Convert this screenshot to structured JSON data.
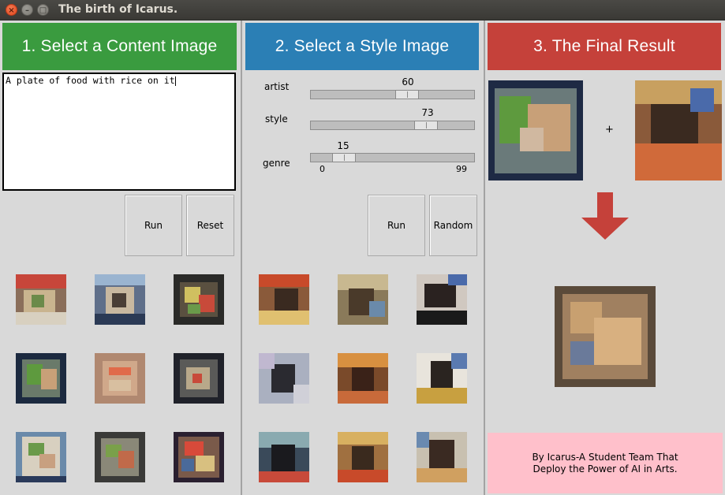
{
  "window": {
    "title": "The birth of Icarus."
  },
  "panel1": {
    "header": "1. Select a Content Image",
    "text_input": "A plate of food with rice on it",
    "run_label": "Run",
    "reset_label": "Reset"
  },
  "panel2": {
    "header": "2. Select a Style Image",
    "sliders": [
      {
        "label": "artist",
        "value": "60"
      },
      {
        "label": "style",
        "value": "73"
      },
      {
        "label": "genre",
        "value": "15",
        "min": "0",
        "max": "99"
      }
    ],
    "run_label": "Run",
    "random_label": "Random"
  },
  "panel3": {
    "header": "3. The Final Result",
    "plus": "+",
    "footer_line1": "By Icarus-A Student Team That",
    "footer_line2": "Deploy the Power of AI in Arts."
  },
  "colors": {
    "header1": "#3a9b3f",
    "header2": "#2b7fb5",
    "header3": "#c5413a",
    "footer_bg": "#ffc0cb",
    "arrow": "#c5413a"
  },
  "icons": [
    "close-icon",
    "minimize-icon",
    "maximize-icon",
    "down-arrow-icon"
  ]
}
